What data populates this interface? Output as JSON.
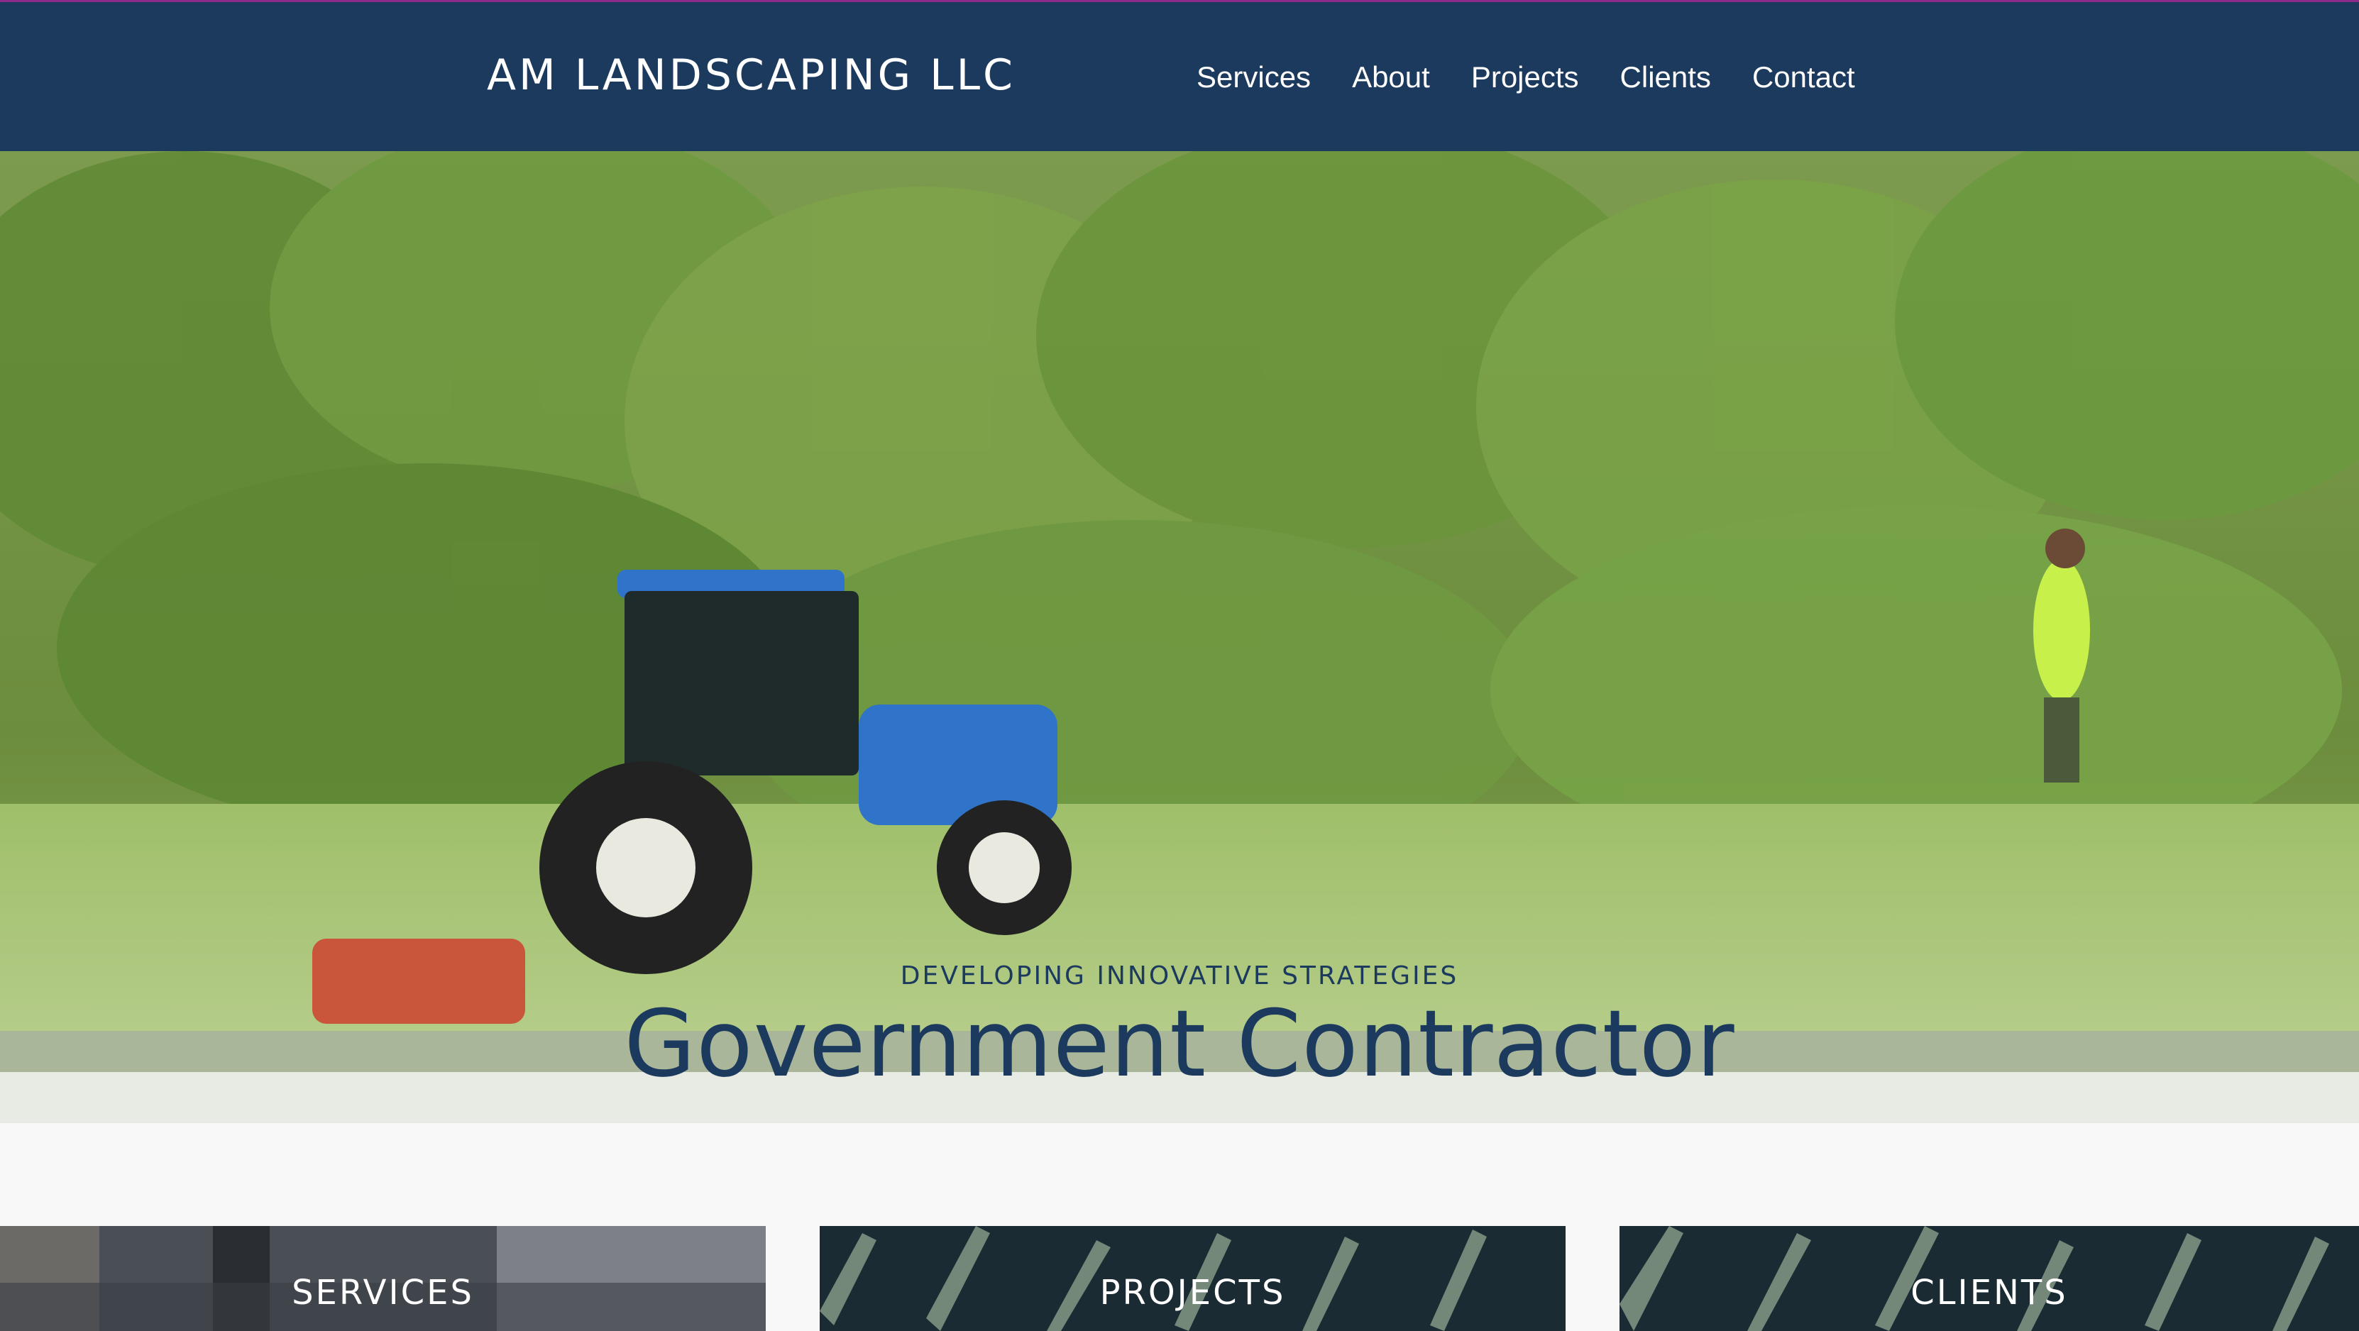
{
  "brand": "AM LANDSCAPING LLC",
  "nav": [
    "Services",
    "About",
    "Projects",
    "Clients",
    "Contact"
  ],
  "hero": {
    "tagline": "DEVELOPING INNOVATIVE STRATEGIES",
    "headline": "Government Contractor",
    "image": "tractor-mowing-brush-photo"
  },
  "tiles": [
    {
      "label": "SERVICES",
      "image": "truck-bed-photo"
    },
    {
      "label": "PROJECTS",
      "image": "fern-leaves-photo"
    },
    {
      "label": "CLIENTS",
      "image": "fern-leaves-photo"
    }
  ],
  "colors": {
    "header": "#1b3a5e",
    "accent_line": "#8e2a8c",
    "page_bg": "#f8f8f8",
    "text_primary": "#1b3a5e"
  }
}
